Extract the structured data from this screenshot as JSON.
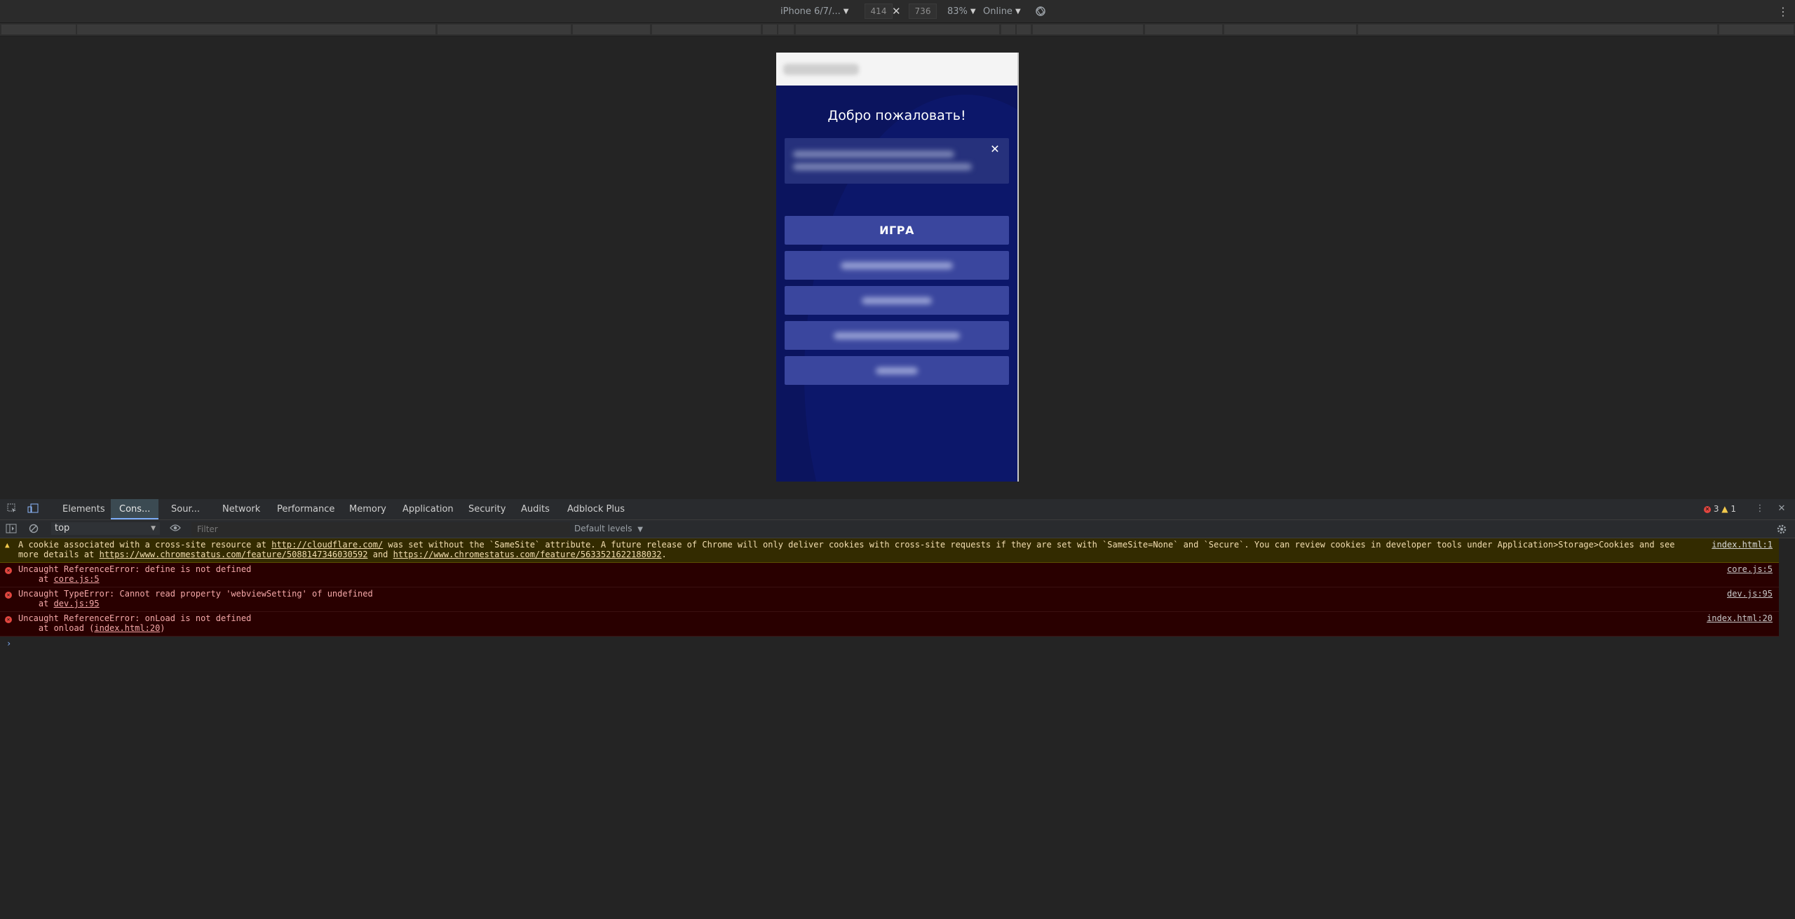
{
  "device_toolbar": {
    "device": "iPhone 6/7/...",
    "width": "414",
    "height": "736",
    "times": "✕",
    "zoom": "83%",
    "network": "Online",
    "more": "⋮"
  },
  "phone": {
    "welcome": "Добро пожаловать!",
    "close_symbol": "✕",
    "primary_button": "ИГРА"
  },
  "devtools": {
    "tabs": [
      "Elements",
      "Cons...",
      "Sour...",
      "Network",
      "Performance",
      "Memory",
      "Application",
      "Security",
      "Audits",
      "Adblock Plus"
    ],
    "error_count": "3",
    "warning_count": "1",
    "context": "top",
    "filter_placeholder": "Filter",
    "levels": "Default levels",
    "messages": [
      {
        "type": "warning",
        "line1_a": "A cookie associated with a cross-site resource at ",
        "line1_link": "http://cloudflare.com/",
        "line1_b": " was set without the `SameSite` attribute. A future release of Chrome will only deliver cookies with cross-site requests if they are set with `SameSite=None` and `Secure`. You can review cookies in developer tools under Application>Storage>Cookies and see",
        "line2_a": "more details at ",
        "line2_link1": "https://www.chromestatus.com/feature/5088147346030592",
        "line2_mid": " and ",
        "line2_link2": "https://www.chromestatus.com/feature/5633521622188032",
        "line2_end": ".",
        "source": "index.html:1"
      },
      {
        "type": "error",
        "line1": "Uncaught ReferenceError: define is not defined",
        "line2_prefix": "    at ",
        "line2_link": "core.js:5",
        "line2_suffix": "",
        "source": "core.js:5"
      },
      {
        "type": "error",
        "line1": "Uncaught TypeError: Cannot read property 'webviewSetting' of undefined",
        "line2_prefix": "    at ",
        "line2_link": "dev.js:95",
        "line2_suffix": "",
        "source": "dev.js:95"
      },
      {
        "type": "error",
        "line1": "Uncaught ReferenceError: onLoad is not defined",
        "line2_prefix": "    at onload (",
        "line2_link": "index.html:20",
        "line2_suffix": ")",
        "source": "index.html:20"
      }
    ],
    "prompt": "›"
  },
  "icons": {
    "inspect": "inspect-element-icon",
    "device": "device-toggle-icon",
    "sidebar": "sidebar-toggle-icon",
    "clear": "clear-console-icon",
    "eye": "live-expression-icon",
    "settings": "gear-icon",
    "rotate": "rotate-icon"
  },
  "colors": {
    "phone_bg": "#0b145e",
    "button_bg": "#3a469e",
    "warning_bg": "#332b00",
    "error_bg": "#290000",
    "accent": "#7cacf8"
  }
}
